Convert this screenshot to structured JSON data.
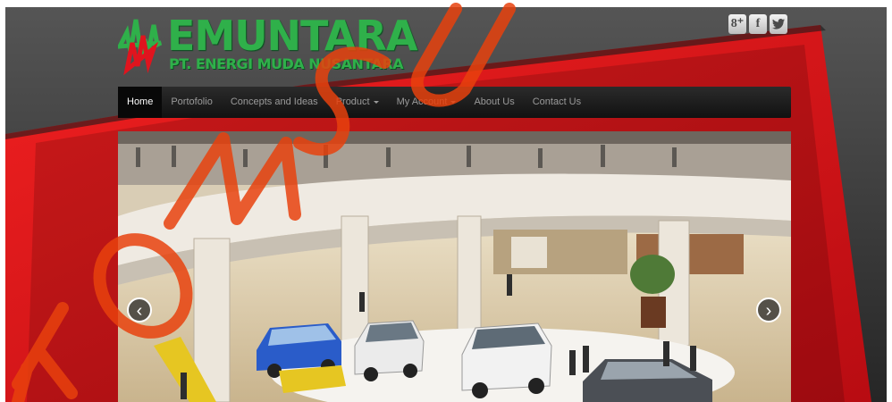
{
  "brand": {
    "name": "EMUNTARA",
    "tagline": "PT. ENERGI MUDA NUSANTARA",
    "colors": {
      "green": "#2fb04a",
      "red": "#e0141e"
    }
  },
  "social": [
    {
      "icon": "google-plus-icon",
      "glyph": "8⁺"
    },
    {
      "icon": "facebook-icon",
      "glyph": "f"
    },
    {
      "icon": "twitter-icon",
      "glyph": "🐦"
    }
  ],
  "nav": {
    "items": [
      {
        "label": "Home",
        "active": true
      },
      {
        "label": "Portofolio"
      },
      {
        "label": "Concepts and Ideas"
      },
      {
        "label": "Product",
        "dropdown": true
      },
      {
        "label": "My Account",
        "dropdown": true
      },
      {
        "label": "About Us"
      },
      {
        "label": "Contact Us"
      }
    ]
  },
  "carousel": {
    "prev_glyph": "‹",
    "next_glyph": "›",
    "image": "mall-atrium-car-exhibition-photo"
  },
  "watermark": "KOMSU"
}
